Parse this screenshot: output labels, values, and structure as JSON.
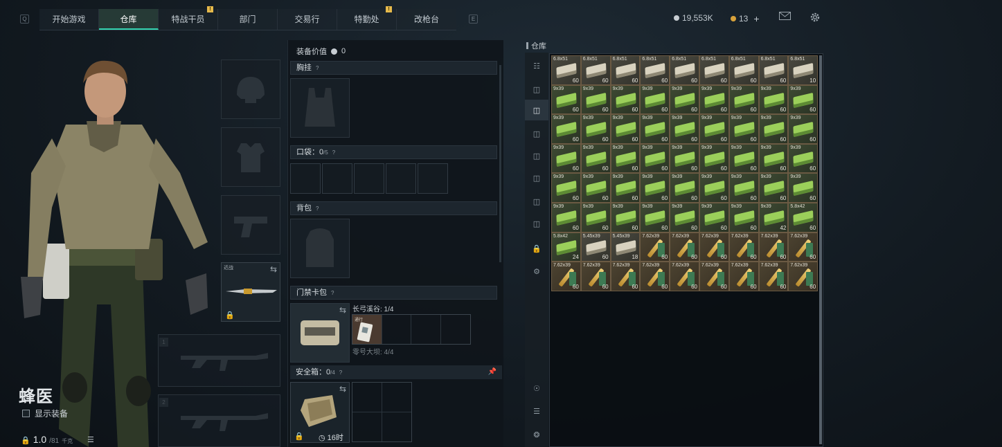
{
  "nav": {
    "left_key": "Q",
    "right_key": "E",
    "tabs": [
      {
        "label": "开始游戏",
        "active": false,
        "badge": ""
      },
      {
        "label": "仓库",
        "active": true,
        "badge": ""
      },
      {
        "label": "特战干员",
        "active": false,
        "badge": "!"
      },
      {
        "label": "部门",
        "active": false,
        "badge": ""
      },
      {
        "label": "交易行",
        "active": false,
        "badge": ""
      },
      {
        "label": "特勤处",
        "active": false,
        "badge": "!"
      },
      {
        "label": "改枪台",
        "active": false,
        "badge": ""
      }
    ],
    "currency": "19,553K",
    "premium": "13",
    "add_symbol": "+",
    "coin_color": "#c7cdd2",
    "premium_color": "#d8a23b",
    "accent_color": "#34d5b1"
  },
  "character": {
    "name": "蜂医",
    "show_gear_label": "显示装备",
    "weight": "1.0",
    "weight_cap": "/81",
    "weight_unit": "千克",
    "melee_label": "近战",
    "weapon_slot_1": "1",
    "weapon_slot_2": "2"
  },
  "loadout": {
    "value_label": "装备价值",
    "value": "0",
    "chest_rig": "胸挂",
    "pockets_label": "口袋",
    "pockets_used": "0",
    "pockets_total": "/5",
    "backpack": "背包",
    "keycard_case": "门禁卡包",
    "keycard_line1": "长弓溪谷: 1/4",
    "keycard_line2": "零号大坝: 4/4",
    "keycard_item_tag": "通行",
    "safe_label": "安全箱",
    "safe_used": "0",
    "safe_total": "/4",
    "safe_time": "16时",
    "help": "?"
  },
  "stash": {
    "label": "仓库",
    "items": [
      {
        "cal": "6.8x51",
        "count": "60",
        "kind": "grey"
      },
      {
        "cal": "6.8x51",
        "count": "60",
        "kind": "grey"
      },
      {
        "cal": "6.8x51",
        "count": "60",
        "kind": "grey"
      },
      {
        "cal": "6.8x51",
        "count": "60",
        "kind": "grey"
      },
      {
        "cal": "6.8x51",
        "count": "60",
        "kind": "grey"
      },
      {
        "cal": "6.8x51",
        "count": "60",
        "kind": "grey"
      },
      {
        "cal": "6.8x51",
        "count": "60",
        "kind": "grey"
      },
      {
        "cal": "6.8x51",
        "count": "60",
        "kind": "grey"
      },
      {
        "cal": "6.8x51",
        "count": "10",
        "kind": "grey"
      },
      {
        "cal": "9x39",
        "count": "60",
        "kind": "green"
      },
      {
        "cal": "9x39",
        "count": "60",
        "kind": "green"
      },
      {
        "cal": "9x39",
        "count": "60",
        "kind": "green"
      },
      {
        "cal": "9x39",
        "count": "60",
        "kind": "green"
      },
      {
        "cal": "9x39",
        "count": "60",
        "kind": "green"
      },
      {
        "cal": "9x39",
        "count": "60",
        "kind": "green"
      },
      {
        "cal": "9x39",
        "count": "60",
        "kind": "green"
      },
      {
        "cal": "9x39",
        "count": "60",
        "kind": "green"
      },
      {
        "cal": "9x39",
        "count": "60",
        "kind": "green"
      },
      {
        "cal": "9x39",
        "count": "60",
        "kind": "green"
      },
      {
        "cal": "9x39",
        "count": "60",
        "kind": "green"
      },
      {
        "cal": "9x39",
        "count": "60",
        "kind": "green"
      },
      {
        "cal": "9x39",
        "count": "60",
        "kind": "green"
      },
      {
        "cal": "9x39",
        "count": "60",
        "kind": "green"
      },
      {
        "cal": "9x39",
        "count": "60",
        "kind": "green"
      },
      {
        "cal": "9x39",
        "count": "60",
        "kind": "green"
      },
      {
        "cal": "9x39",
        "count": "60",
        "kind": "green"
      },
      {
        "cal": "9x39",
        "count": "60",
        "kind": "green"
      },
      {
        "cal": "9x39",
        "count": "60",
        "kind": "green"
      },
      {
        "cal": "9x39",
        "count": "60",
        "kind": "green"
      },
      {
        "cal": "9x39",
        "count": "60",
        "kind": "green"
      },
      {
        "cal": "9x39",
        "count": "60",
        "kind": "green"
      },
      {
        "cal": "9x39",
        "count": "60",
        "kind": "green"
      },
      {
        "cal": "9x39",
        "count": "60",
        "kind": "green"
      },
      {
        "cal": "9x39",
        "count": "60",
        "kind": "green"
      },
      {
        "cal": "9x39",
        "count": "60",
        "kind": "green"
      },
      {
        "cal": "9x39",
        "count": "60",
        "kind": "green"
      },
      {
        "cal": "9x39",
        "count": "60",
        "kind": "green"
      },
      {
        "cal": "9x39",
        "count": "60",
        "kind": "green"
      },
      {
        "cal": "9x39",
        "count": "60",
        "kind": "green"
      },
      {
        "cal": "9x39",
        "count": "60",
        "kind": "green"
      },
      {
        "cal": "9x39",
        "count": "60",
        "kind": "green"
      },
      {
        "cal": "9x39",
        "count": "60",
        "kind": "green"
      },
      {
        "cal": "9x39",
        "count": "60",
        "kind": "green"
      },
      {
        "cal": "9x39",
        "count": "60",
        "kind": "green"
      },
      {
        "cal": "9x39",
        "count": "60",
        "kind": "green"
      },
      {
        "cal": "9x39",
        "count": "60",
        "kind": "green"
      },
      {
        "cal": "9x39",
        "count": "60",
        "kind": "green"
      },
      {
        "cal": "9x39",
        "count": "60",
        "kind": "green"
      },
      {
        "cal": "9x39",
        "count": "60",
        "kind": "green"
      },
      {
        "cal": "9x39",
        "count": "60",
        "kind": "green"
      },
      {
        "cal": "9x39",
        "count": "60",
        "kind": "green"
      },
      {
        "cal": "9x39",
        "count": "60",
        "kind": "green"
      },
      {
        "cal": "9x39",
        "count": "42",
        "kind": "green"
      },
      {
        "cal": "5.8x42",
        "count": "60",
        "kind": "green"
      },
      {
        "cal": "5.8x42",
        "count": "24",
        "kind": "green"
      },
      {
        "cal": "5.45x39",
        "count": "60",
        "kind": "grey"
      },
      {
        "cal": "5.45x39",
        "count": "18",
        "kind": "grey"
      },
      {
        "cal": "7.62x39",
        "count": "60",
        "kind": "brown"
      },
      {
        "cal": "7.62x39",
        "count": "60",
        "kind": "brown"
      },
      {
        "cal": "7.62x39",
        "count": "60",
        "kind": "brown"
      },
      {
        "cal": "7.62x39",
        "count": "60",
        "kind": "brown"
      },
      {
        "cal": "7.62x39",
        "count": "60",
        "kind": "brown"
      },
      {
        "cal": "7.62x39",
        "count": "60",
        "kind": "brown"
      },
      {
        "cal": "7.62x39",
        "count": "60",
        "kind": "brown"
      },
      {
        "cal": "7.62x39",
        "count": "60",
        "kind": "brown"
      },
      {
        "cal": "7.62x39",
        "count": "60",
        "kind": "brown"
      },
      {
        "cal": "7.62x39",
        "count": "60",
        "kind": "brown"
      },
      {
        "cal": "7.62x39",
        "count": "60",
        "kind": "brown"
      },
      {
        "cal": "7.62x39",
        "count": "60",
        "kind": "brown"
      },
      {
        "cal": "7.62x39",
        "count": "60",
        "kind": "brown"
      },
      {
        "cal": "7.62x39",
        "count": "60",
        "kind": "brown"
      },
      {
        "cal": "7.62x39",
        "count": "60",
        "kind": "brown"
      }
    ]
  }
}
